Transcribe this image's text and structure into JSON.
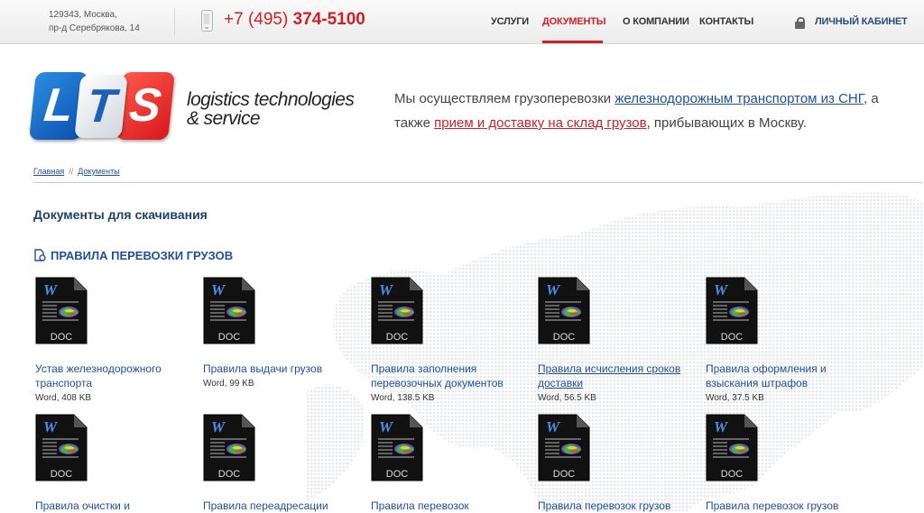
{
  "header": {
    "address_line1": "129343, Москва,",
    "address_line2": "пр-д Серебрякова, 14",
    "phone_prefix": "+7 (495) ",
    "phone_number": "374-5100",
    "nav": [
      {
        "label": "Услуги",
        "active": false
      },
      {
        "label": "Документы",
        "active": true
      },
      {
        "label": "О компании",
        "active": false
      },
      {
        "label": "Контакты",
        "active": false
      }
    ],
    "cabinet_label": "Личный кабинет",
    "accent_color": "#d21f26"
  },
  "logo": {
    "letters": [
      "L",
      "T",
      "S"
    ],
    "tagline_line1": "logistics technologies",
    "tagline_line2": "& service"
  },
  "intro": {
    "part1": "Мы осуществляем грузоперевозки ",
    "link1": "железнодорожным транспортом из СНГ",
    "part2": ", а также ",
    "link2": "прием и доставку на склад грузов",
    "part3": ", прибывающих в Москву."
  },
  "breadcrumb": {
    "home": "Главная",
    "separator": "//",
    "current": "Документы"
  },
  "page_title": "Документы для скачивания",
  "section_title": "Правила перевозки грузов",
  "doc_badge": "DOC",
  "doc_letter": "W",
  "documents": [
    {
      "title": "Устав железнодорожного транспорта",
      "meta": "Word, 408 KB"
    },
    {
      "title": "Правила выдачи грузов",
      "meta": "Word, 99 KB"
    },
    {
      "title": "Правила заполнения перевозочных документов",
      "meta": "Word, 138.5 KB"
    },
    {
      "title": "Правила исчисления сроков доставки",
      "meta": "Word, 56.5 KB"
    },
    {
      "title": "Правила оформления и взыскания штрафов",
      "meta": "Word, 37.5 KB"
    },
    {
      "title": "Правила очистки и",
      "meta": ""
    },
    {
      "title": "Правила переадресации",
      "meta": ""
    },
    {
      "title": "Правила перевозок",
      "meta": ""
    },
    {
      "title": "Правила перевозок грузов",
      "meta": ""
    },
    {
      "title": "Правила перевозок грузов",
      "meta": ""
    }
  ]
}
